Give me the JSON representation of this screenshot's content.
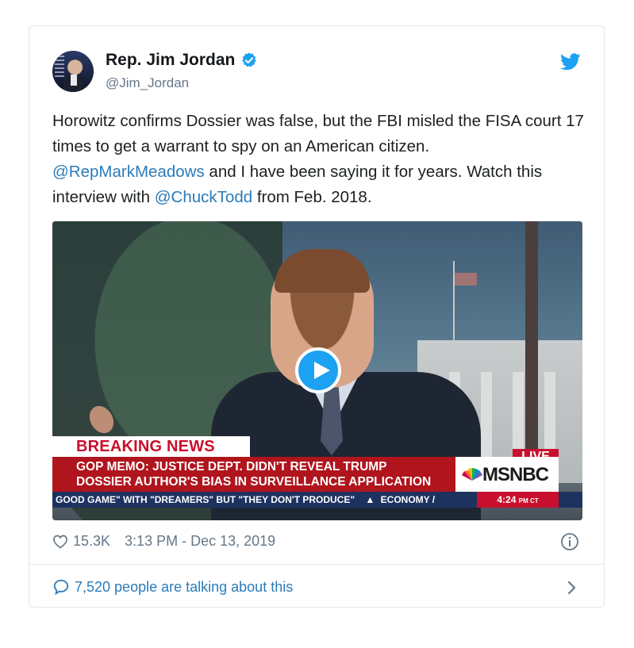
{
  "author": {
    "display_name": "Rep. Jim Jordan",
    "handle": "@Jim_Jordan"
  },
  "tweet": {
    "text_1": "Horowitz confirms Dossier was false, but the FBI misled the FISA court 17 times to get a warrant to spy on an American citizen.",
    "mention_1": "@RepMarkMeadows",
    "text_2": " and I have been saying it for years. Watch this interview with ",
    "mention_2": "@ChuckTodd",
    "text_3": " from Feb. 2018."
  },
  "video": {
    "breaking_label": "BREAKING NEWS",
    "headline_line1": "GOP MEMO: JUSTICE DEPT. DIDN'T REVEAL TRUMP",
    "headline_line2": "DOSSIER AUTHOR'S BIAS IN SURVEILLANCE APPLICATION",
    "live_label": "LIVE",
    "network": "MSNBC",
    "ticker_text": "GOOD GAME\" WITH \"DREAMERS\" BUT \"THEY DON'T PRODUCE\"",
    "ticker_topic": "ECONOMY /",
    "ticker_time": "4:24",
    "ticker_tz": "PM CT"
  },
  "meta": {
    "likes": "15.3K",
    "timestamp": "3:13 PM - Dec 13, 2019"
  },
  "conversation": {
    "label": "7,520 people are talking about this"
  },
  "icons": {
    "verified": "verified-badge-icon",
    "bird": "twitter-bird-icon",
    "heart": "heart-icon",
    "info": "info-icon",
    "bubble": "reply-bubble-icon",
    "chevron": "chevron-right-icon",
    "play": "play-icon"
  },
  "colors": {
    "brand_blue": "#1da1f2",
    "link_blue": "#2b7bb9",
    "meta_gray": "#657786",
    "breaking_red": "#b0141d"
  }
}
